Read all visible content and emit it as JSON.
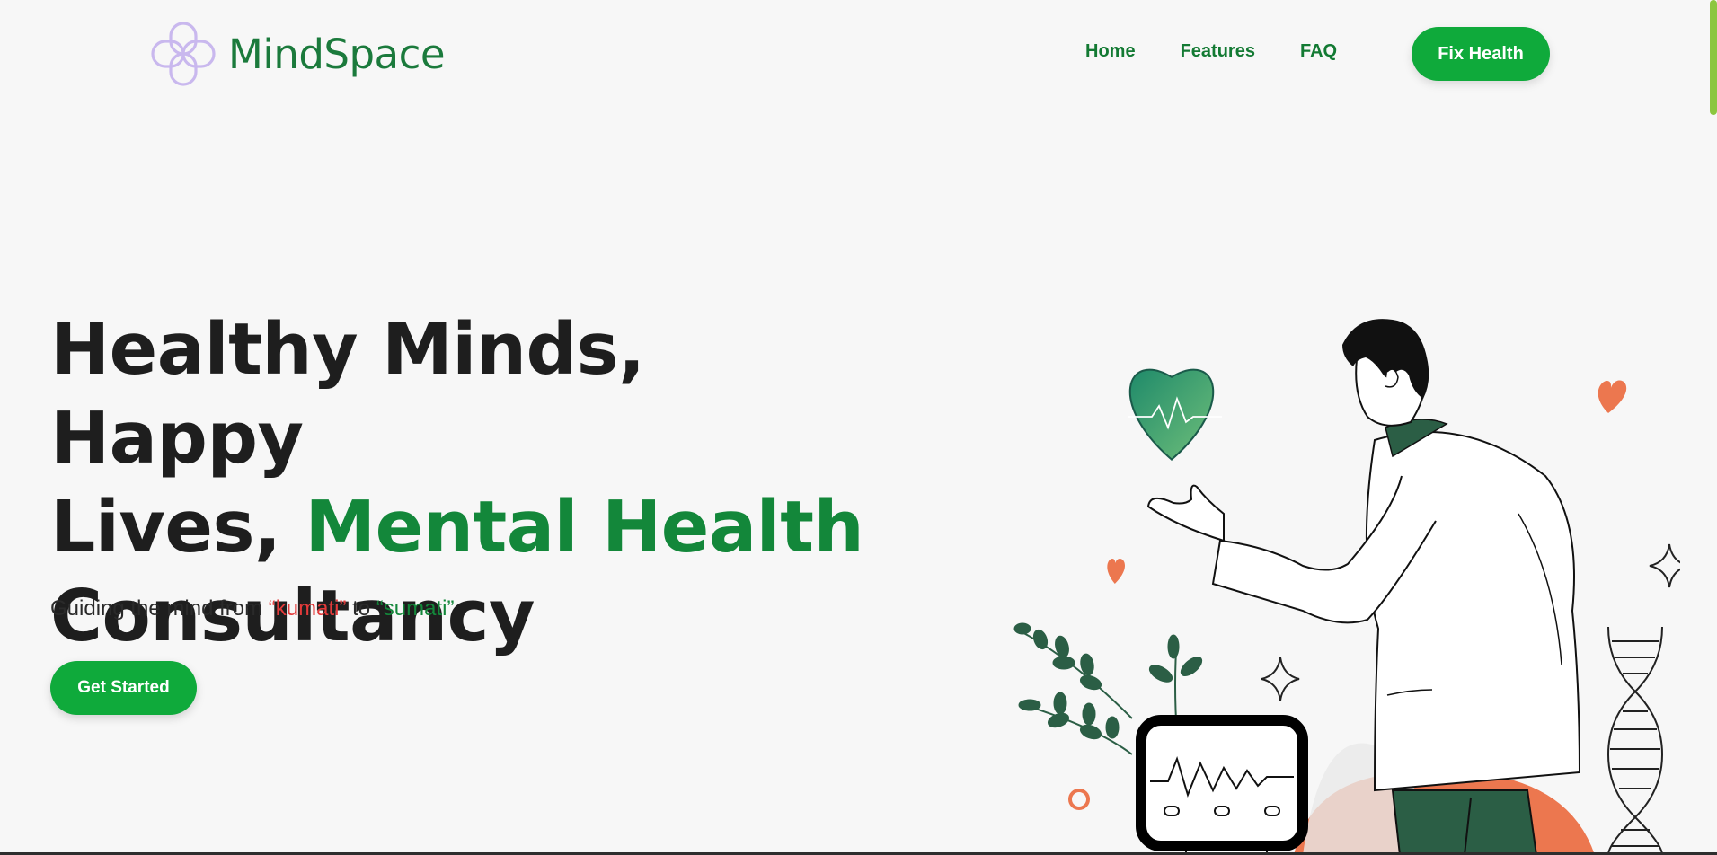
{
  "brand": {
    "name": "MindSpace"
  },
  "nav": {
    "items": [
      {
        "label": "Home"
      },
      {
        "label": "Features"
      },
      {
        "label": "FAQ"
      }
    ],
    "cta_label": "Fix Health"
  },
  "hero": {
    "title_line1": "Healthy Minds, Happy",
    "title_line2_start": "Lives, ",
    "title_line2_accent": "Mental Health",
    "title_line3": "Consultancy",
    "subtitle_prefix": "Guiding the mind from ",
    "subtitle_word1": "“kumati”",
    "subtitle_middle": " to ",
    "subtitle_word2": "“sumati”",
    "cta_label": "Get Started"
  },
  "colors": {
    "brand_green": "#0faa3b",
    "text_green": "#13873a",
    "accent_red": "#e33a3a",
    "logo_lavender": "#c9b8ee",
    "heart_orange": "#ec774f",
    "pants_green": "#2b5e45",
    "scrollbar": "#8cc63f"
  },
  "icons": {
    "logo": "four-loop-knot-icon",
    "heart": "heart-pulse-icon",
    "monitor": "heart-rate-monitor-icon",
    "dna": "dna-helix-icon",
    "sparkle": "sparkle-icon"
  }
}
